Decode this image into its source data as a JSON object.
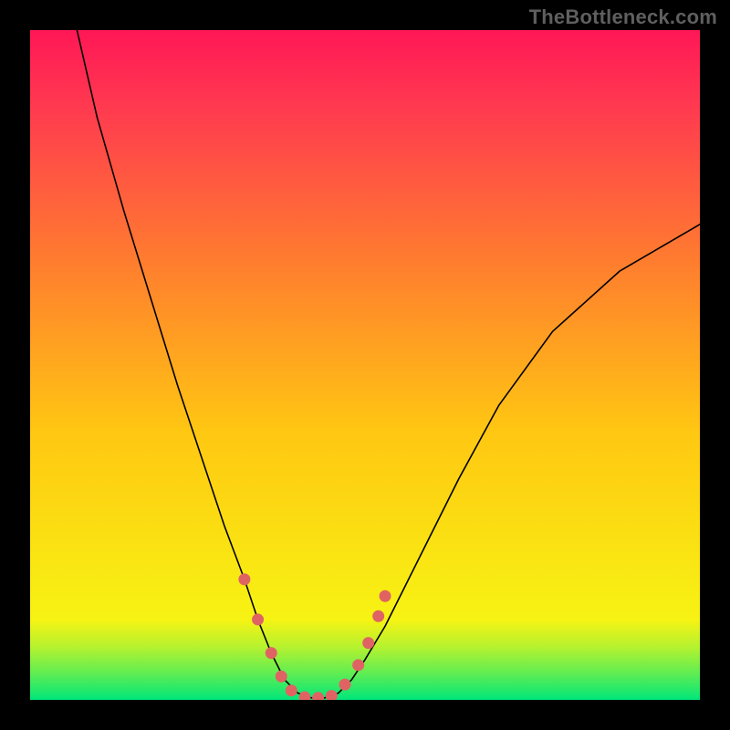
{
  "watermark": "TheBottleneck.com",
  "chart_data": {
    "type": "line",
    "title": "",
    "xlabel": "",
    "ylabel": "",
    "xlim": [
      0,
      100
    ],
    "ylim": [
      0,
      100
    ],
    "grid": false,
    "background_gradient": [
      {
        "stop": 0.0,
        "color": "#00e67a"
      },
      {
        "stop": 0.04,
        "color": "#61ed52"
      },
      {
        "stop": 0.08,
        "color": "#b7f22e"
      },
      {
        "stop": 0.12,
        "color": "#f7f313"
      },
      {
        "stop": 0.4,
        "color": "#ffc712"
      },
      {
        "stop": 0.65,
        "color": "#ff7e2e"
      },
      {
        "stop": 0.88,
        "color": "#ff3b4f"
      },
      {
        "stop": 1.0,
        "color": "#ff1756"
      }
    ],
    "series": [
      {
        "name": "bottleneck-curve",
        "stroke": "#000000",
        "stroke_width": 1.6,
        "x": [
          7,
          10,
          14,
          18,
          22,
          26,
          29,
          32,
          34,
          36,
          38,
          40,
          42,
          44,
          46,
          48,
          50,
          53,
          56,
          60,
          64,
          70,
          78,
          88,
          100
        ],
        "y": [
          100,
          87,
          73,
          60,
          47,
          35,
          26,
          18,
          12,
          7,
          3,
          1,
          0.3,
          0.3,
          1,
          3,
          6,
          11,
          17,
          25,
          33,
          44,
          55,
          64,
          71
        ]
      }
    ],
    "marker_band": {
      "name": "optimal-range-band",
      "color": "#e06363",
      "radius": 6.5,
      "points": [
        {
          "x": 32,
          "y": 18
        },
        {
          "x": 34,
          "y": 12
        },
        {
          "x": 36,
          "y": 7
        },
        {
          "x": 37.5,
          "y": 3.5
        },
        {
          "x": 39,
          "y": 1.4
        },
        {
          "x": 41,
          "y": 0.4
        },
        {
          "x": 43,
          "y": 0.3
        },
        {
          "x": 45,
          "y": 0.6
        },
        {
          "x": 47,
          "y": 2.3
        },
        {
          "x": 49,
          "y": 5.2
        },
        {
          "x": 50.5,
          "y": 8.5
        },
        {
          "x": 52,
          "y": 12.5
        },
        {
          "x": 53,
          "y": 15.5
        }
      ]
    }
  }
}
